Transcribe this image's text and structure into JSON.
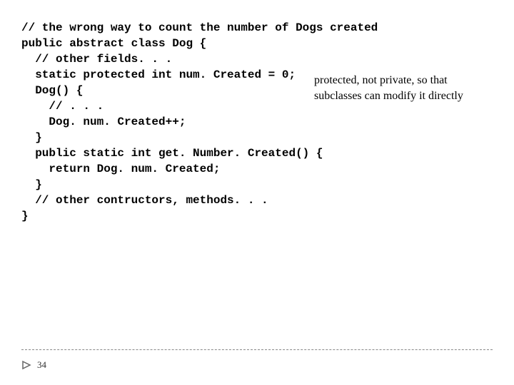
{
  "code": {
    "l01": "// the wrong way to count the number of Dogs created",
    "l02": "public abstract class Dog {",
    "l03": "  // other fields. . .",
    "l04": "  static protected int num. Created = 0;",
    "l05": "",
    "l06": "  Dog() {",
    "l07": "    // . . .",
    "l08": "    Dog. num. Created++;",
    "l09": "  }",
    "l10": "",
    "l11": "  public static int get. Number. Created() {",
    "l12": "    return Dog. num. Created;",
    "l13": "  }",
    "l14": "",
    "l15": "  // other contructors, methods. . .",
    "l16": "}"
  },
  "annotation": {
    "text": "protected, not private, so that subclasses can modify it directly"
  },
  "footer": {
    "page": "34",
    "icon": "play-marker-icon"
  }
}
